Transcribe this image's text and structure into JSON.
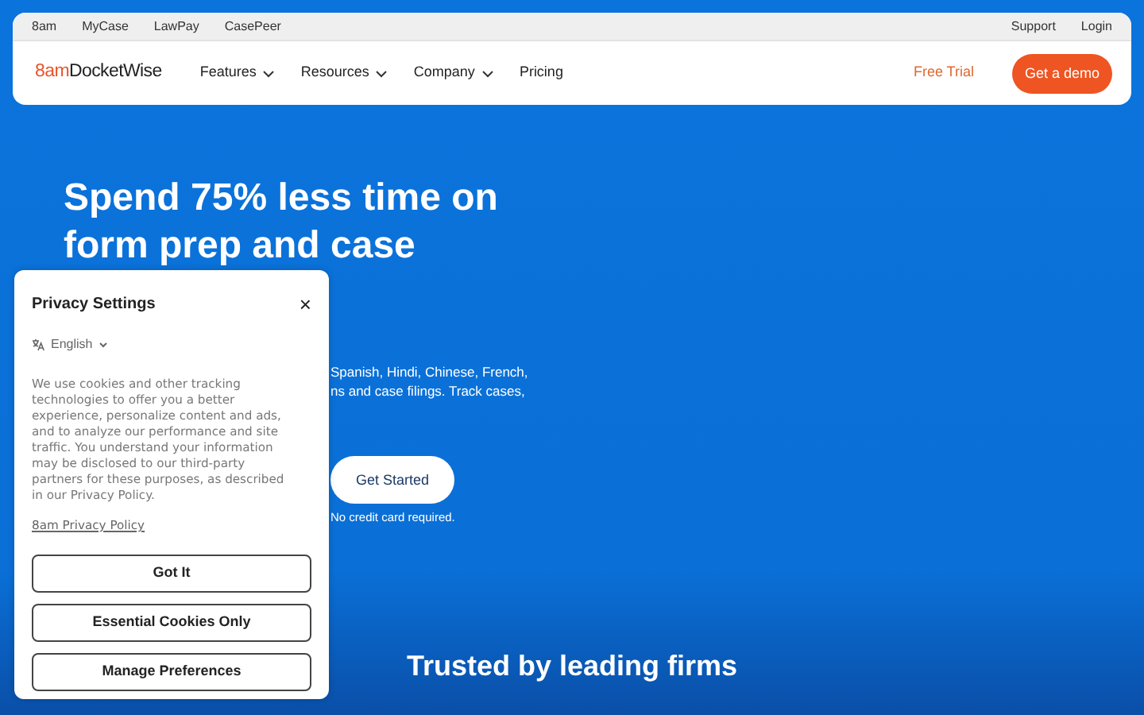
{
  "top_links": [
    {
      "label": "8am"
    },
    {
      "label": "MyCase"
    },
    {
      "label": "LawPay"
    },
    {
      "label": "CasePeer"
    }
  ],
  "top_right_links": [
    {
      "label": "Support"
    },
    {
      "label": "Login"
    }
  ],
  "logo": {
    "prefix": "8am",
    "name": "DocketWise"
  },
  "nav": [
    {
      "label": "Features",
      "dropdown": true
    },
    {
      "label": "Resources",
      "dropdown": true
    },
    {
      "label": "Company",
      "dropdown": true
    },
    {
      "label": "Pricing",
      "dropdown": false
    }
  ],
  "free_trial": "Free Trial",
  "demo_button": "Get a demo",
  "hero": {
    "heading_lines": [
      "Spend 75% less time on",
      "form prep and case"
    ],
    "body_lines": [
      "Spanish, Hindi, Chinese, French,",
      "ns and case filings. Track cases,"
    ],
    "cta": "Get Started",
    "note": "No credit card required."
  },
  "trusted": "Trusted by leading firms",
  "privacy": {
    "title": "Privacy Settings",
    "close": "×",
    "language": "English",
    "text": "We use cookies and other tracking technologies to offer you a better experience, personalize content and ads, and to analyze our performance and site traffic.  You understand your information may be disclosed to our third-party partners for these purposes, as described in our Privacy Policy.",
    "policy_link": "8am Privacy Policy",
    "buttons": [
      "Got It",
      "Essential Cookies Only",
      "Manage Preferences"
    ]
  }
}
